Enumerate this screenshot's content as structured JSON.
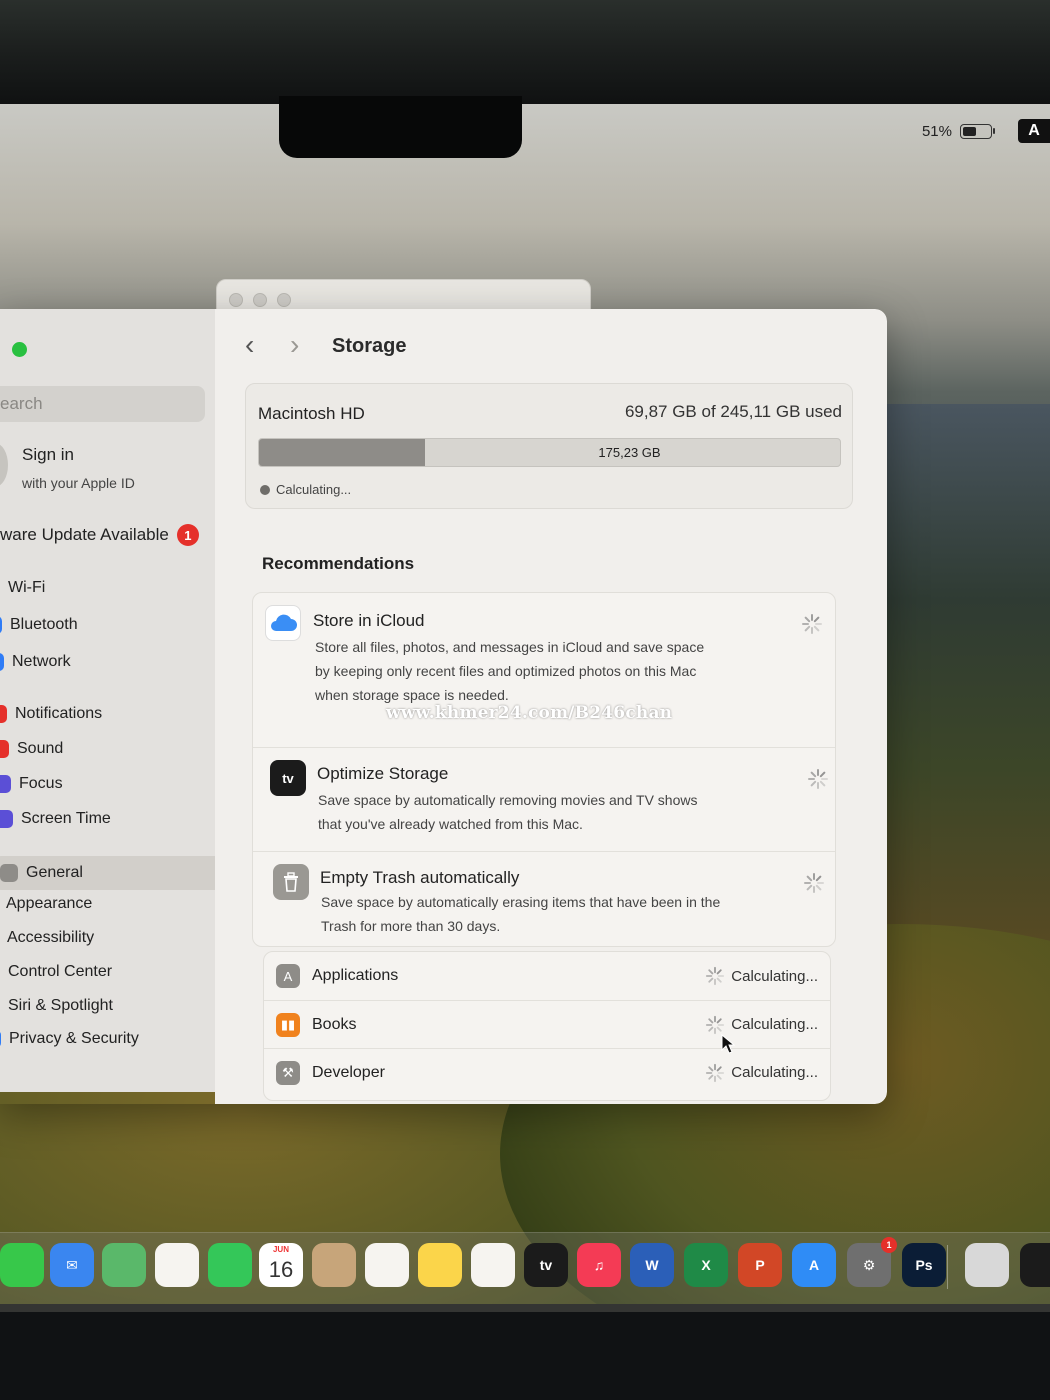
{
  "menubar": {
    "battery_percent": "51%",
    "battery_level": 0.51,
    "input_source": "A"
  },
  "window": {
    "title": "Storage",
    "search_placeholder": "earch",
    "signin": {
      "title": "Sign in",
      "subtitle": "with your Apple ID"
    },
    "update": {
      "label": "ware Update Available",
      "badge": "1"
    },
    "sidebar_items": [
      {
        "label": "Wi-Fi",
        "icon": "wifi-icon",
        "color": "#2f7cf6"
      },
      {
        "label": "Bluetooth",
        "icon": "bluetooth-icon",
        "color": "#2f7cf6"
      },
      {
        "label": "Network",
        "icon": "network-icon",
        "color": "#2f7cf6"
      },
      {
        "label": "Notifications",
        "icon": "notifications-icon",
        "color": "#e5302a"
      },
      {
        "label": "Sound",
        "icon": "sound-icon",
        "color": "#e5302a"
      },
      {
        "label": "Focus",
        "icon": "focus-icon",
        "color": "#5b4fd6"
      },
      {
        "label": "Screen Time",
        "icon": "screen-time-icon",
        "color": "#5b4fd6"
      },
      {
        "label": "General",
        "icon": "gear-icon",
        "color": "#8e8c88",
        "selected": true
      },
      {
        "label": "Appearance",
        "icon": "appearance-icon",
        "color": "#1d1d1f"
      },
      {
        "label": "Accessibility",
        "icon": "accessibility-icon",
        "color": "#2f7cf6"
      },
      {
        "label": "Control Center",
        "icon": "control-center-icon",
        "color": "#8e8c88"
      },
      {
        "label": "Siri & Spotlight",
        "icon": "siri-icon",
        "color": "#3a3a6a"
      },
      {
        "label": "Privacy & Security",
        "icon": "hand-icon",
        "color": "#2f7cf6"
      }
    ],
    "disk": {
      "name": "Macintosh HD",
      "usage": "69,87 GB of 245,11 GB used",
      "used_fraction": 0.285,
      "free": "175,23 GB",
      "status": "Calculating..."
    },
    "recommendations_title": "Recommendations",
    "recommendations": [
      {
        "title": "Store in iCloud",
        "icon": "icloud-icon",
        "description": "Store all files, photos, and messages in iCloud and save space by keeping only recent files and optimized photos on this Mac when storage space is needed."
      },
      {
        "title": "Optimize Storage",
        "icon": "apple-tv-icon",
        "icon_text": "tv",
        "description": "Save space by automatically removing movies and TV shows that you've already watched from this Mac."
      },
      {
        "title": "Empty Trash automatically",
        "icon": "trash-icon",
        "description": "Save space by automatically erasing items that have been in the Trash for more than 30 days."
      }
    ],
    "watermark": "www.khmer24.com/B246chan",
    "categories": [
      {
        "label": "Applications",
        "icon": "app-store-icon",
        "color": "#8e8c88",
        "status": "Calculating..."
      },
      {
        "label": "Books",
        "icon": "books-icon",
        "color": "#f0821e",
        "status": "Calculating..."
      },
      {
        "label": "Developer",
        "icon": "hammer-icon",
        "color": "#8e8c88",
        "status": "Calculating..."
      }
    ]
  },
  "dock": {
    "calendar": {
      "month": "JUN",
      "day": "16"
    },
    "apps": [
      {
        "name": "messages-icon",
        "color": "#37c84a",
        "label": ""
      },
      {
        "name": "mail-icon",
        "color": "#3a86f0",
        "label": "✉"
      },
      {
        "name": "maps-icon",
        "color": "#5ab86a",
        "label": ""
      },
      {
        "name": "photos-icon",
        "color": "#f6f4f0",
        "label": ""
      },
      {
        "name": "facetime-icon",
        "color": "#34c759",
        "label": ""
      },
      {
        "name": "calendar-icon",
        "color": "#ffffff",
        "label": ""
      },
      {
        "name": "contacts-icon",
        "color": "#c7a57a",
        "label": ""
      },
      {
        "name": "reminders-icon",
        "color": "#f6f4f0",
        "label": ""
      },
      {
        "name": "notes-icon",
        "color": "#fbd54a",
        "label": ""
      },
      {
        "name": "freeform-icon",
        "color": "#f6f4f0",
        "label": ""
      },
      {
        "name": "apple-tv-icon",
        "color": "#1b1b1b",
        "label": "tv"
      },
      {
        "name": "music-icon",
        "color": "#f43b55",
        "label": "♫"
      },
      {
        "name": "word-icon",
        "color": "#2b5fb8",
        "label": "W"
      },
      {
        "name": "excel-icon",
        "color": "#1f8a47",
        "label": "X"
      },
      {
        "name": "powerpoint-icon",
        "color": "#d24726",
        "label": "P"
      },
      {
        "name": "app-store-icon",
        "color": "#2f8cf6",
        "label": "A"
      },
      {
        "name": "system-settings-icon",
        "color": "#6f6f6f",
        "label": "⚙"
      },
      {
        "name": "photoshop-icon",
        "color": "#0b1d36",
        "label": "Ps"
      },
      {
        "name": "mirroring-icon",
        "color": "#d8d8d8",
        "label": ""
      },
      {
        "name": "activity-icon",
        "color": "#1b1b1b",
        "label": ""
      }
    ],
    "settings_badge": "1"
  }
}
